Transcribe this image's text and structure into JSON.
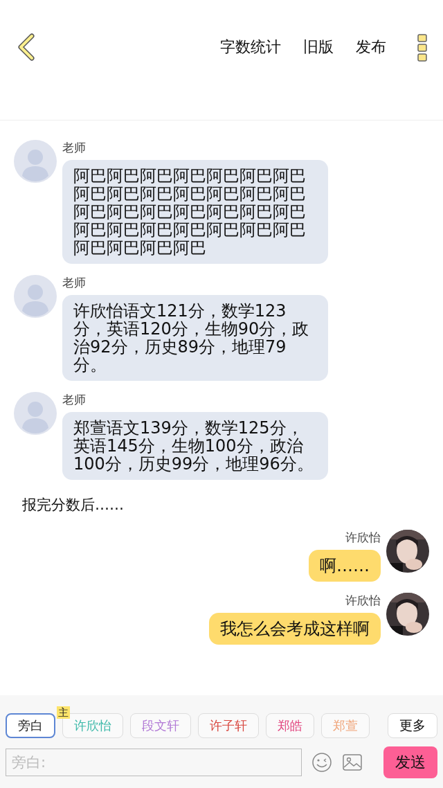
{
  "header": {
    "actions": [
      "字数统计",
      "旧版",
      "发布"
    ]
  },
  "messages": [
    {
      "kind": "left",
      "name": "老师",
      "text": "阿巴阿巴阿巴阿巴阿巴阿巴阿巴阿巴阿巴阿巴阿巴阿巴阿巴阿巴阿巴阿巴阿巴阿巴阿巴阿巴阿巴阿巴阿巴阿巴阿巴阿巴阿巴阿巴阿巴阿巴阿巴阿巴"
    },
    {
      "kind": "left",
      "name": "老师",
      "text": "许欣怡语文121分，数学123分，英语120分，生物90分，政治92分，历史89分，地理79分。"
    },
    {
      "kind": "left",
      "name": "老师",
      "text": "郑萱语文139分，数学125分，英语145分，生物100分，政治100分，历史99分，地理96分。"
    },
    {
      "kind": "narration",
      "text": "报完分数后……"
    },
    {
      "kind": "right",
      "name": "许欣怡",
      "text": "啊……"
    },
    {
      "kind": "right",
      "name": "许欣怡",
      "text": "我怎么会考成这样啊"
    }
  ],
  "composer": {
    "roles": [
      {
        "label": "旁白",
        "color": "#222222",
        "selected": true
      },
      {
        "label": "许欣怡",
        "color": "#3db9a9",
        "selected": false,
        "main_badge": "主"
      },
      {
        "label": "段文轩",
        "color": "#b27ad6",
        "selected": false
      },
      {
        "label": "许子轩",
        "color": "#d8473f",
        "selected": false
      },
      {
        "label": "郑皓",
        "color": "#e2457f",
        "selected": false
      },
      {
        "label": "郑萱",
        "color": "#f0a57a",
        "selected": false
      }
    ],
    "more": "更多",
    "input": {
      "placeholder": "旁白:"
    },
    "send": "发送"
  }
}
